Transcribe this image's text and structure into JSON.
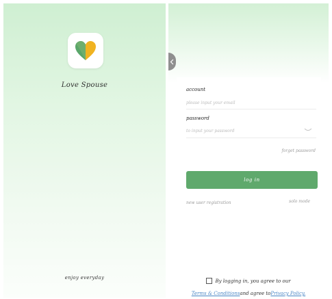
{
  "splash": {
    "app_name": "Love Spouse",
    "tagline": "enjoy everyday",
    "icon": "heart-icon",
    "colors": {
      "heart_left": "#5aa66a",
      "heart_right": "#f0b321"
    }
  },
  "login": {
    "account_label": "account",
    "account_placeholder": "please input your email",
    "password_label": "password",
    "password_placeholder": "to input your password",
    "forget_password": "forget password",
    "login_button": "log in",
    "new_user": "new user registration",
    "solo_mode": "solo mode",
    "agree_text": "By logging in, you agree to our",
    "terms_link": "Terms & Conditions",
    "and_agree": "and agree to",
    "privacy_link": "Privacy Policy.",
    "colors": {
      "accent": "#5fa96c",
      "link": "#4a86c5"
    }
  }
}
